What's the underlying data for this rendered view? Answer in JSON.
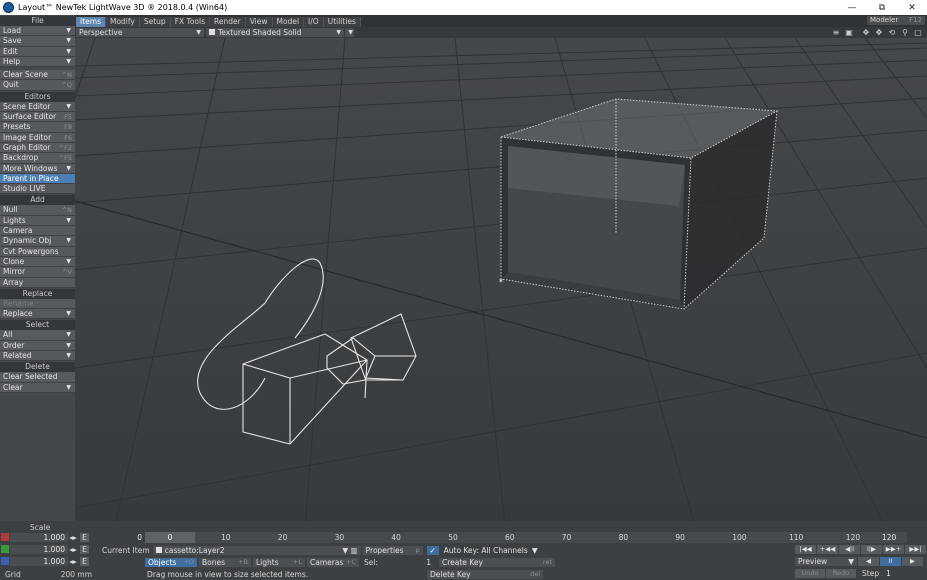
{
  "window": {
    "title": "Layout™ NewTek LightWave 3D ® 2018.0.4 (Win64)",
    "buttons": [
      "—",
      "⧉",
      "✕"
    ]
  },
  "sidebar": {
    "groups": [
      {
        "title": "File",
        "items": [
          {
            "label": "Load",
            "dropdown": true
          },
          {
            "label": "Save",
            "dropdown": true
          },
          {
            "label": "Edit",
            "dropdown": true
          },
          {
            "label": "Help",
            "dropdown": true
          },
          {
            "gap": true
          },
          {
            "label": "Clear Scene",
            "shortcut": "^N"
          },
          {
            "label": "Quit",
            "shortcut": "^Q"
          }
        ]
      },
      {
        "title": "Editors",
        "items": [
          {
            "label": "Scene Editor",
            "dropdown": true
          },
          {
            "label": "Surface Editor",
            "shortcut": "F5"
          },
          {
            "label": "Presets",
            "shortcut": "F8"
          },
          {
            "label": "Image Editor",
            "shortcut": "F6"
          },
          {
            "label": "Graph Editor",
            "shortcut": "^F2"
          },
          {
            "label": "Backdrop",
            "shortcut": "^F5"
          },
          {
            "label": "More Windows",
            "dropdown": true
          },
          {
            "label": "Parent in Place",
            "highlight": true
          },
          {
            "label": "Studio LIVE"
          }
        ]
      },
      {
        "title": "Add",
        "items": [
          {
            "label": "Null",
            "shortcut": "^N"
          },
          {
            "label": "Lights",
            "dropdown": true
          },
          {
            "label": "Camera"
          },
          {
            "label": "Dynamic Obj",
            "dropdown": true
          },
          {
            "label": "Cvt Powergons"
          },
          {
            "label": "Clone",
            "dropdown": true
          },
          {
            "label": "Mirror",
            "shortcut": "^V"
          },
          {
            "label": "Array"
          }
        ]
      },
      {
        "title": "Replace",
        "items": [
          {
            "label": "Rename",
            "disabled": true
          },
          {
            "label": "Replace",
            "dropdown": true
          }
        ]
      },
      {
        "title": "Select",
        "items": [
          {
            "label": "All",
            "dropdown": true
          },
          {
            "label": "Order",
            "dropdown": true
          },
          {
            "label": "Related",
            "dropdown": true
          }
        ]
      },
      {
        "title": "Delete",
        "items": [
          {
            "label": "Clear Selected"
          },
          {
            "label": "Clear",
            "dropdown": true
          }
        ]
      }
    ]
  },
  "menu_tabs": [
    "Items",
    "Modify",
    "Setup",
    "FX Tools",
    "Render",
    "View",
    "Model",
    "I/O",
    "Utilities"
  ],
  "active_tab": "Items",
  "modeler": {
    "label": "Modeler",
    "key": "F12"
  },
  "viewport_bar": {
    "view": "Perspective",
    "shading": "Textured Shaded Solid"
  },
  "timeline": {
    "scale_label": "Scale",
    "x_value": "1.000",
    "y_value": "1.000",
    "z_value": "1.000",
    "grid_label": "Grid",
    "grid_value": "200 mm",
    "start_frame": "0",
    "knob_value": "0",
    "end_frame": "120",
    "ticks": [
      "10",
      "20",
      "30",
      "40",
      "50",
      "60",
      "70",
      "80",
      "90",
      "100",
      "110",
      "120"
    ],
    "current_item_label": "Current Item",
    "current_item": "cassetto:Layer2",
    "properties": {
      "label": "Properties",
      "key": "p"
    },
    "autokey": "Auto Key: All Channels",
    "filters": [
      {
        "label": "Objects",
        "key": "+O",
        "active": true
      },
      {
        "label": "Bones",
        "key": "+B"
      },
      {
        "label": "Lights",
        "key": "+L"
      },
      {
        "label": "Cameras",
        "key": "+C"
      }
    ],
    "sel_label": "Sel:",
    "sel_value": "1",
    "create_key": "Create Key",
    "create_key_sc": "ret",
    "delete_key": "Delete Key",
    "delete_key_sc": "del",
    "status": "Drag mouse in view to size selected items.",
    "preview": "Preview",
    "step_label": "Step",
    "step_value": "1",
    "undo": "Undo",
    "redo": "Redo",
    "play_row1": [
      "|◀◀",
      "+◀◀",
      "◀|I",
      "I|▶",
      "▶▶+",
      "▶▶|"
    ],
    "play_row2": [
      "◀",
      "II",
      "▶"
    ]
  }
}
